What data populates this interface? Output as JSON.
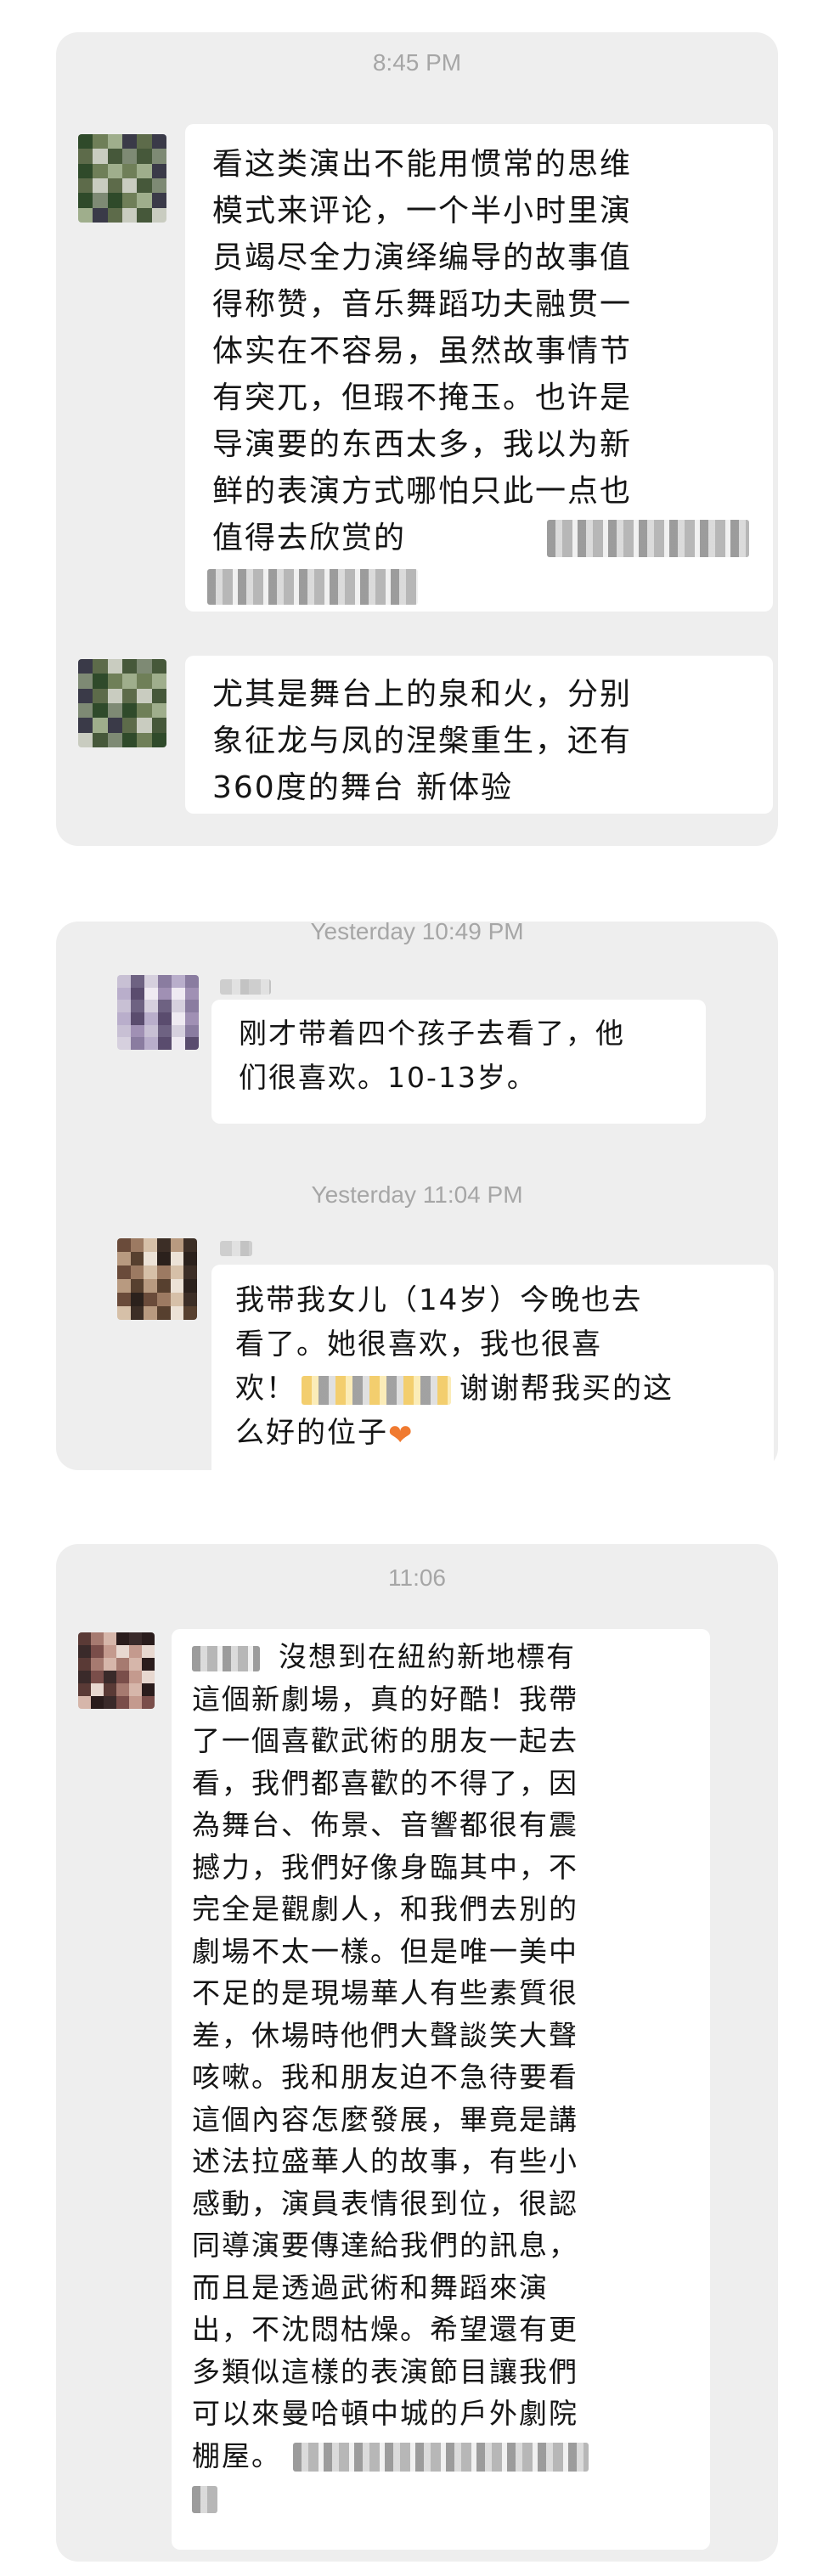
{
  "screenshots": [
    {
      "timestamp": "8:45 PM",
      "messages": [
        {
          "text": "看这类演出不能用惯常的思维\n模式来评论，一个半小时里演\n员竭尽全力演绎编导的故事值\n得称赞，音乐舞蹈功夫融贯一\n体实在不容易，虽然故事情节\n有突兀，但瑕不掩玉。也许是\n导演要的东西太多，我以为新\n鲜的表演方式哪怕只此一点也\n值得去欣赏的"
        },
        {
          "text": "尤其是舞台上的泉和火，分别\n象征龙与凤的涅槃重生，还有\n360度的舞台 新体验"
        }
      ]
    },
    {
      "timestamps": [
        "Yesterday 10:49 PM",
        "Yesterday 11:04 PM"
      ],
      "messages": [
        {
          "text": "刚才带着四个孩子去看了，他\n们很喜欢。10-13岁。"
        },
        {
          "line1": "我带我女儿（14岁）今晚也去",
          "line2": "看了。她很喜欢，我也很喜",
          "line3_prefix": "欢！",
          "line3_suffix": "谢谢帮我买的这",
          "line4": "么好的位子",
          "heart": "❤"
        }
      ]
    },
    {
      "timestamp": "11:06",
      "messages": [
        {
          "first_line": "沒想到在紐約新地標有",
          "text": "這個新劇場，真的好酷！我帶\n了一個喜歡武術的朋友一起去\n看，我們都喜歡的不得了，因\n為舞台、佈景、音響都很有震\n撼力，我們好像身臨其中，不\n完全是觀劇人，和我們去別的\n劇場不太一樣。但是唯一美中\n不足的是現場華人有些素質很\n差，休場時他們大聲談笑大聲\n咳嗽。我和朋友迫不急待要看\n這個內容怎麼發展，畢竟是講\n述法拉盛華人的故事，有些小\n感動，演員表情很到位，很認\n同導演要傳達給我們的訊息，\n而且是透過武術和舞蹈來演\n出，不沈悶枯燥。希望還有更\n多類似這樣的表演節目讓我們\n可以來曼哈頓中城的戶外劇院",
          "last_line": "棚屋。"
        }
      ]
    }
  ],
  "icons": {
    "heart": "orange-heart-emoji",
    "avatar": "pixelated-avatar",
    "redacted": "pixelated-redaction"
  },
  "colors": {
    "panel_bg": "#eeeeee",
    "bubble_bg": "#ffffff",
    "timestamp": "#a6a6a6",
    "heart": "#f07a30"
  }
}
